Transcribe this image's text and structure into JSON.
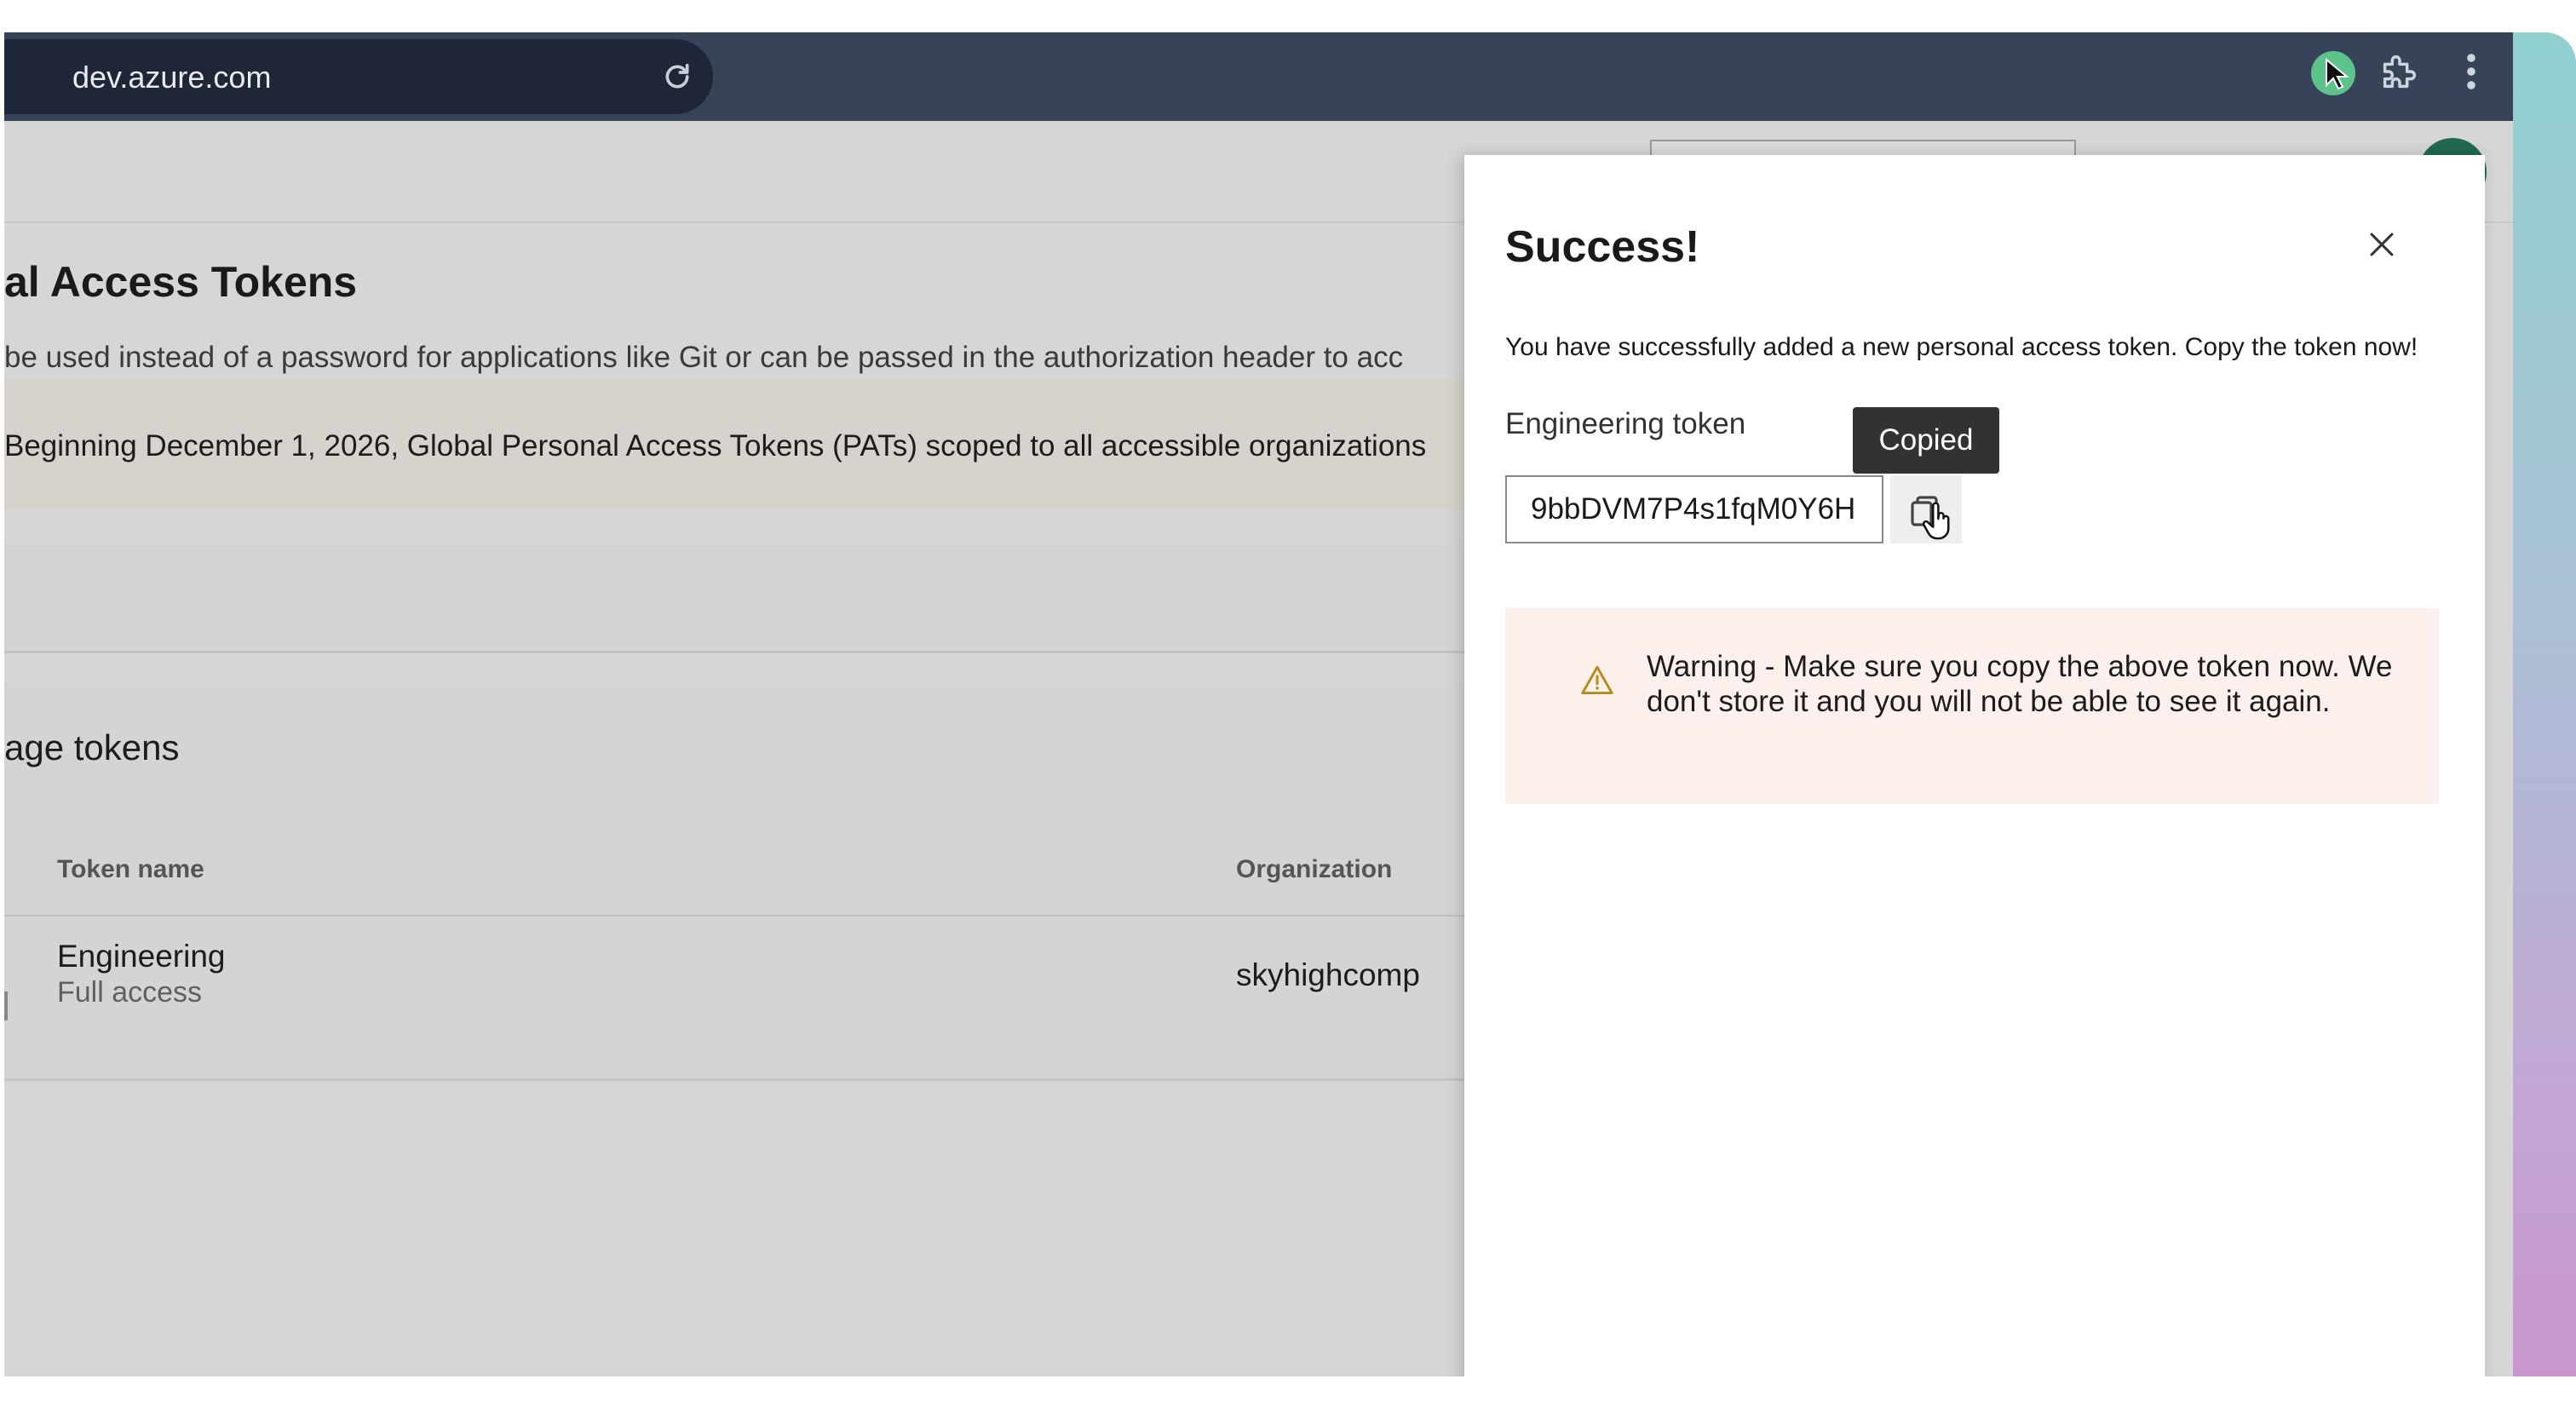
{
  "browser": {
    "url": "dev.azure.com"
  },
  "page": {
    "title": "al Access Tokens",
    "subtitle": "be used instead of a password for applications like Git or can be passed in the authorization header to acc",
    "notice": "Beginning December 1, 2026, Global Personal Access Tokens (PATs) scoped to all accessible organizations",
    "manage_section_title": "age tokens",
    "table": {
      "columns": [
        "Token name",
        "Organization"
      ],
      "rows": [
        {
          "name": "Engineering",
          "scope": "Full access",
          "organization": "skyhighcomp"
        }
      ]
    }
  },
  "dialog": {
    "title": "Success!",
    "message": "You have successfully added a new personal access token. Copy the token now!",
    "token_label": "Engineering token",
    "token_value": "9bbDVM7P4s1fqM0Y6H",
    "tooltip": "Copied",
    "warning": "Warning - Make sure you copy the above token now. We don't store it and you will not be able to see it again."
  },
  "colors": {
    "toolbar": "#374359",
    "avatar": "#1f6a50",
    "warning_bg": "#fbf0ec",
    "warning_icon": "#b88a1a"
  },
  "icons": [
    "reload-icon",
    "cursor-extension-icon",
    "puzzle-icon",
    "more-vertical-icon",
    "close-icon",
    "copy-icon",
    "hand-cursor-icon",
    "warning-icon"
  ]
}
